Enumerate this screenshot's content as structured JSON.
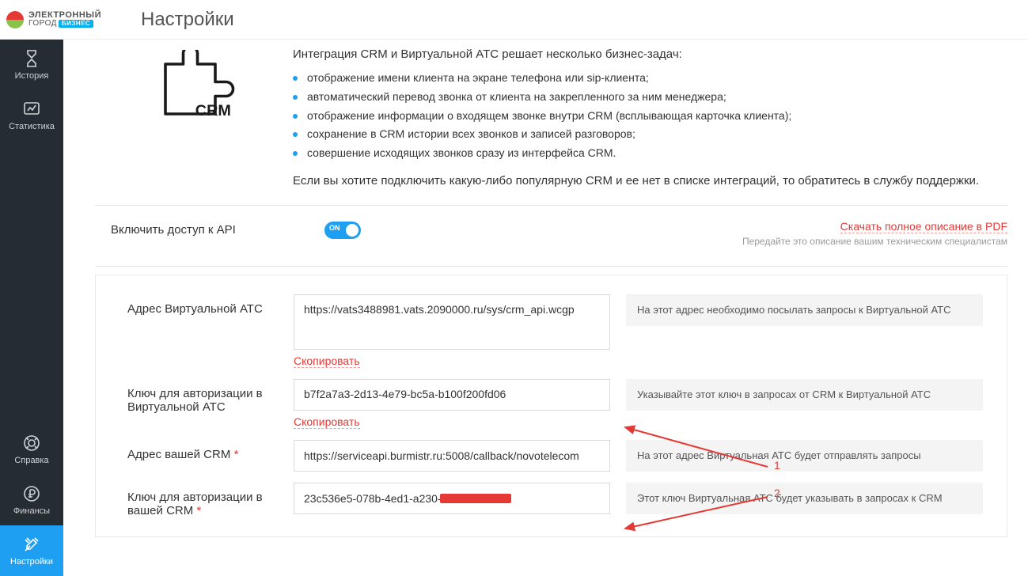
{
  "brand": {
    "line1": "ЭЛЕКТРОННЫЙ",
    "line2": "ГОРОД",
    "badge": "БИЗНЕС"
  },
  "page_title": "Настройки",
  "nav": {
    "top": [
      {
        "id": "history",
        "label": "История"
      },
      {
        "id": "stats",
        "label": "Статистика"
      }
    ],
    "bottom": [
      {
        "id": "help",
        "label": "Справка"
      },
      {
        "id": "finance",
        "label": "Финансы"
      },
      {
        "id": "settings",
        "label": "Настройки",
        "active": true
      }
    ]
  },
  "intro": {
    "lead": "Интеграция CRM и Виртуальной АТС решает несколько бизнес-задач:",
    "bullets": [
      "отображение имени клиента на экране телефона или sip-клиента;",
      "автоматический перевод звонка от клиента на закрепленного за ним менеджера;",
      "отображение информации о входящем звонке внутри CRM (всплывающая карточка клиента);",
      "сохранение в CRM истории всех звонков и записей разговоров;",
      "совершение исходящих звонков сразу из интерфейса CRM."
    ],
    "tail": "Если вы хотите подключить какую-либо популярную CRM и ее нет в списке интеграций, то обратитесь в службу поддержки."
  },
  "api": {
    "toggle_label": "Включить доступ к API",
    "toggle_on": "ON",
    "pdf_link": "Скачать полное описание в PDF",
    "pdf_sub": "Передайте это описание вашим техническим специалистам"
  },
  "form": {
    "copy_label": "Скопировать",
    "rows": [
      {
        "label": "Адрес Виртуальной АТС",
        "required": false,
        "value": "https://vats3488981.vats.2090000.ru/sys/crm_api.wcgp",
        "help": "На этот адрес необходимо посылать запросы к Виртуальной АТС",
        "copy": true,
        "tall": true
      },
      {
        "label": "Ключ для авторизации в Виртуальной АТС",
        "required": false,
        "value": "b7f2a7a3-2d13-4e79-bc5a-b100f200fd06",
        "help": "Указывайте этот ключ в запросах от CRM к Виртуальной АТС",
        "copy": true,
        "tall": false
      },
      {
        "label": "Адрес вашей CRM",
        "required": true,
        "value": "https://serviceapi.burmistr.ru:5008/callback/novotelecom",
        "help": "На этот адрес Виртуальная АТС будет отправлять запросы",
        "copy": false,
        "tall": false
      },
      {
        "label": "Ключ для авторизации в вашей CRM",
        "required": true,
        "value": "23c536e5-078b-4ed1-a230-",
        "help": "Этот ключ Виртуальная АТС будет указывать в запросах к CRM",
        "copy": false,
        "tall": false
      }
    ]
  },
  "annotations": {
    "label1": "1",
    "label2": "2"
  }
}
